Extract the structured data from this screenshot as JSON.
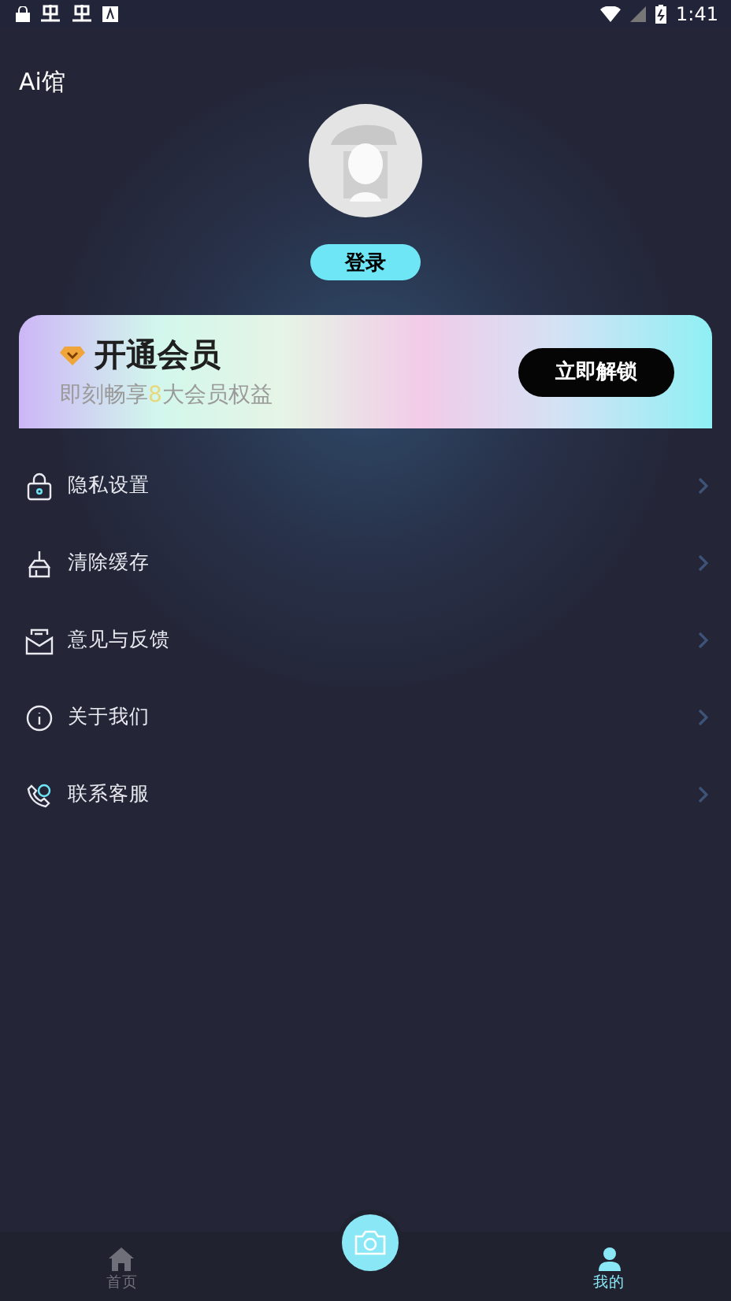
{
  "status_bar": {
    "time": "1:41"
  },
  "app_title": "Ai馆",
  "profile": {
    "login_label": "登录"
  },
  "vip_banner": {
    "title": "开通会员",
    "subtitle": {
      "before": "即刻畅享",
      "highlight": "8",
      "after": "大会员权益"
    },
    "button": "立即解锁"
  },
  "menu": [
    {
      "kind": "lock",
      "label": "隐私设置"
    },
    {
      "kind": "broom",
      "label": "清除缓存"
    },
    {
      "kind": "mail",
      "label": "意见与反馈"
    },
    {
      "kind": "info",
      "label": "关于我们"
    },
    {
      "kind": "phone",
      "label": "联系客服"
    }
  ],
  "bottom_nav": [
    {
      "kind": "home",
      "label": "首页",
      "selected": false
    },
    {
      "kind": "camera"
    },
    {
      "kind": "user",
      "label": "我的",
      "selected": true
    }
  ]
}
